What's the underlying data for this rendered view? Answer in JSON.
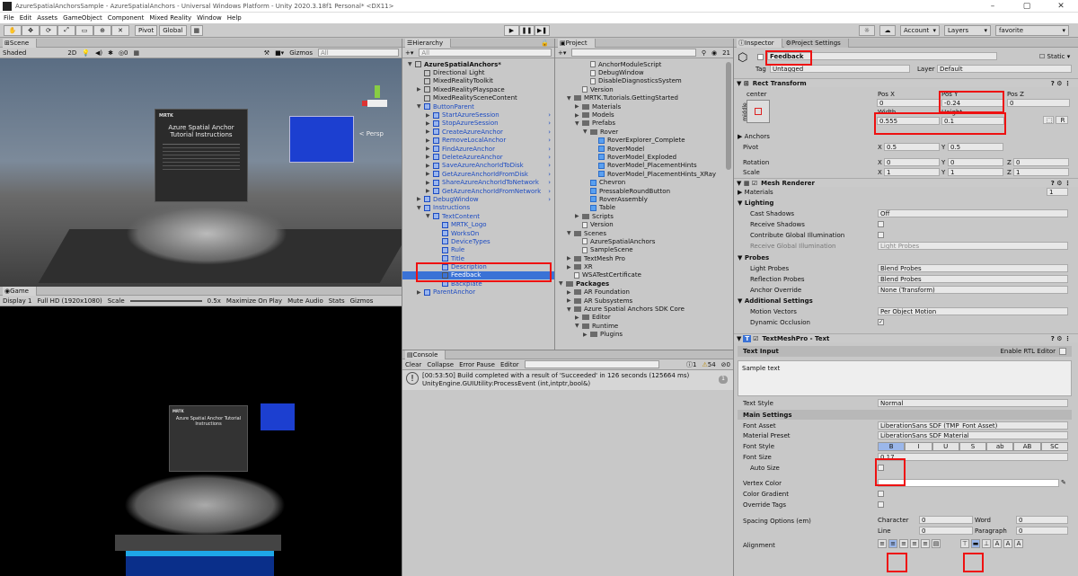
{
  "window": {
    "title": "AzureSpatialAnchorsSample - AzureSpatialAnchors - Universal Windows Platform - Unity 2020.3.18f1 Personal* <DX11>",
    "controls": [
      "–",
      "▢",
      "✕"
    ]
  },
  "menu": [
    "File",
    "Edit",
    "Assets",
    "GameObject",
    "Component",
    "Mixed Reality",
    "Window",
    "Help"
  ],
  "toolbar": {
    "pivot": "Pivot",
    "global": "Global",
    "account": "Account",
    "layers": "Layers",
    "layout": "favorite"
  },
  "scene": {
    "tab": "Scene",
    "shading": "Shaded",
    "mode2d": "2D",
    "gizmos": "Gizmos",
    "search": "All",
    "persp": "< Persp",
    "panel": {
      "brand": "MRTK",
      "title": "Azure Spatial Anchor Tutorial Instructions"
    }
  },
  "game": {
    "tab": "Game",
    "display": "Display 1",
    "resolution": "Full HD (1920x1080)",
    "scale_label": "Scale",
    "scale_value": "0.5x",
    "options": [
      "Maximize On Play",
      "Mute Audio",
      "Stats",
      "Gizmos"
    ],
    "panel": {
      "brand": "MRTK",
      "title": "Azure Spatial Anchor Tutorial Instructions"
    }
  },
  "hierarchy": {
    "tab": "Hierarchy",
    "search": "All",
    "items": [
      {
        "label": "AzureSpatialAnchors*",
        "indent": 0,
        "caret": "▼",
        "kind": "scene"
      },
      {
        "label": "Directional Light",
        "indent": 1,
        "caret": "",
        "kind": "go"
      },
      {
        "label": "MixedRealityToolkit",
        "indent": 1,
        "caret": "",
        "kind": "go"
      },
      {
        "label": "MixedRealityPlayspace",
        "indent": 1,
        "caret": "▶",
        "kind": "go"
      },
      {
        "label": "MixedRealitySceneContent",
        "indent": 1,
        "caret": "",
        "kind": "go"
      },
      {
        "label": "ButtonParent",
        "indent": 1,
        "caret": "▼",
        "kind": "blue"
      },
      {
        "label": "StartAzureSession",
        "indent": 2,
        "caret": "▶",
        "kind": "blue",
        "arrow": true
      },
      {
        "label": "StopAzureSession",
        "indent": 2,
        "caret": "▶",
        "kind": "blue",
        "arrow": true
      },
      {
        "label": "CreateAzureAnchor",
        "indent": 2,
        "caret": "▶",
        "kind": "blue",
        "arrow": true
      },
      {
        "label": "RemoveLocalAnchor",
        "indent": 2,
        "caret": "▶",
        "kind": "blue",
        "arrow": true
      },
      {
        "label": "FindAzureAnchor",
        "indent": 2,
        "caret": "▶",
        "kind": "blue",
        "arrow": true
      },
      {
        "label": "DeleteAzureAnchor",
        "indent": 2,
        "caret": "▶",
        "kind": "blue",
        "arrow": true
      },
      {
        "label": "SaveAzureAnchorIdToDisk",
        "indent": 2,
        "caret": "▶",
        "kind": "blue",
        "arrow": true
      },
      {
        "label": "GetAzureAnchorIdFromDisk",
        "indent": 2,
        "caret": "▶",
        "kind": "blue",
        "arrow": true
      },
      {
        "label": "ShareAzureAnchorIdToNetwork",
        "indent": 2,
        "caret": "▶",
        "kind": "blue",
        "arrow": true
      },
      {
        "label": "GetAzureAnchorIdFromNetwork",
        "indent": 2,
        "caret": "▶",
        "kind": "blue",
        "arrow": true
      },
      {
        "label": "DebugWindow",
        "indent": 1,
        "caret": "▶",
        "kind": "blue",
        "arrow": true
      },
      {
        "label": "Instructions",
        "indent": 1,
        "caret": "▼",
        "kind": "blue"
      },
      {
        "label": "TextContent",
        "indent": 2,
        "caret": "▼",
        "kind": "blue"
      },
      {
        "label": "MRTK_Logo",
        "indent": 3,
        "caret": "",
        "kind": "blue"
      },
      {
        "label": "WorksOn",
        "indent": 3,
        "caret": "",
        "kind": "blue"
      },
      {
        "label": "DeviceTypes",
        "indent": 3,
        "caret": "",
        "kind": "blue"
      },
      {
        "label": "Rule",
        "indent": 3,
        "caret": "",
        "kind": "blue"
      },
      {
        "label": "Title",
        "indent": 3,
        "caret": "",
        "kind": "blue"
      },
      {
        "label": "Description",
        "indent": 3,
        "caret": "",
        "kind": "blue"
      },
      {
        "label": "Feedback",
        "indent": 3,
        "caret": "",
        "kind": "sel"
      },
      {
        "label": "Backplate",
        "indent": 3,
        "caret": "",
        "kind": "blue"
      },
      {
        "label": "ParentAnchor",
        "indent": 1,
        "caret": "▶",
        "kind": "blue"
      }
    ]
  },
  "project": {
    "tab": "Project",
    "count": "21",
    "items": [
      {
        "label": "AnchorModuleScript",
        "indent": 3,
        "kind": "file"
      },
      {
        "label": "DebugWindow",
        "indent": 3,
        "kind": "file"
      },
      {
        "label": "DisableDiagnosticsSystem",
        "indent": 3,
        "kind": "file"
      },
      {
        "label": "Version",
        "indent": 2,
        "kind": "file"
      },
      {
        "label": "MRTK.Tutorials.GettingStarted",
        "indent": 1,
        "kind": "folder",
        "caret": "▼"
      },
      {
        "label": "Materials",
        "indent": 2,
        "kind": "folder",
        "caret": "▶"
      },
      {
        "label": "Models",
        "indent": 2,
        "kind": "folder",
        "caret": "▶"
      },
      {
        "label": "Prefabs",
        "indent": 2,
        "kind": "folder",
        "caret": "▼"
      },
      {
        "label": "Rover",
        "indent": 3,
        "kind": "folder",
        "caret": "▼"
      },
      {
        "label": "RoverExplorer_Complete",
        "indent": 4,
        "kind": "prefab"
      },
      {
        "label": "RoverModel",
        "indent": 4,
        "kind": "prefab"
      },
      {
        "label": "RoverModel_Exploded",
        "indent": 4,
        "kind": "prefab"
      },
      {
        "label": "RoverModel_PlacementHints",
        "indent": 4,
        "kind": "prefab"
      },
      {
        "label": "RoverModel_PlacementHints_XRay",
        "indent": 4,
        "kind": "prefab"
      },
      {
        "label": "Chevron",
        "indent": 3,
        "kind": "prefab"
      },
      {
        "label": "PressableRoundButton",
        "indent": 3,
        "kind": "prefab"
      },
      {
        "label": "RoverAssembly",
        "indent": 3,
        "kind": "prefab"
      },
      {
        "label": "Table",
        "indent": 3,
        "kind": "prefab"
      },
      {
        "label": "Scripts",
        "indent": 2,
        "kind": "folder",
        "caret": "▶"
      },
      {
        "label": "Version",
        "indent": 2,
        "kind": "file"
      },
      {
        "label": "Scenes",
        "indent": 1,
        "kind": "folder",
        "caret": "▼"
      },
      {
        "label": "AzureSpatialAnchors",
        "indent": 2,
        "kind": "file"
      },
      {
        "label": "SampleScene",
        "indent": 2,
        "kind": "file"
      },
      {
        "label": "TextMesh Pro",
        "indent": 1,
        "kind": "folder",
        "caret": "▶"
      },
      {
        "label": "XR",
        "indent": 1,
        "kind": "folder",
        "caret": "▶"
      },
      {
        "label": "WSATestCertificate",
        "indent": 1,
        "kind": "file"
      },
      {
        "label": "Packages",
        "indent": 0,
        "kind": "folder",
        "caret": "▼",
        "bold": true
      },
      {
        "label": "AR Foundation",
        "indent": 1,
        "kind": "folder",
        "caret": "▶"
      },
      {
        "label": "AR Subsystems",
        "indent": 1,
        "kind": "folder",
        "caret": "▶"
      },
      {
        "label": "Azure Spatial Anchors SDK Core",
        "indent": 1,
        "kind": "folder",
        "caret": "▼"
      },
      {
        "label": "Editor",
        "indent": 2,
        "kind": "folder",
        "caret": "▶"
      },
      {
        "label": "Runtime",
        "indent": 2,
        "kind": "folder",
        "caret": "▼"
      },
      {
        "label": "Plugins",
        "indent": 3,
        "kind": "folder",
        "caret": "▶"
      }
    ]
  },
  "console": {
    "tab": "Console",
    "buttons": [
      "Clear",
      "Collapse",
      "Error Pause",
      "Editor"
    ],
    "counts": {
      "info": "1",
      "warn": "54",
      "error": "0"
    },
    "message1": "[00:53:50] Build completed with a result of 'Succeeded' in 126 seconds (125664 ms)",
    "message2": "UnityEngine.GUIUtility:ProcessEvent (int,intptr,bool&)",
    "badge": "1"
  },
  "inspector": {
    "tabs": [
      "Inspector",
      "Project Settings"
    ],
    "name": "Feedback",
    "static": "Static",
    "tag_label": "Tag",
    "tag": "Untagged",
    "layer_label": "Layer",
    "layer": "Default",
    "rect": {
      "title": "Rect Transform",
      "anchor_label": "center",
      "side": "middle",
      "posx_label": "Pos X",
      "posy_label": "Pos Y",
      "posz_label": "Pos Z",
      "posx": "0",
      "posy": "-0.24",
      "posz": "0",
      "width_label": "Width",
      "height_label": "Height",
      "width": "0.555",
      "height": "0.1",
      "r": "R",
      "anchors": "Anchors",
      "pivot": "Pivot",
      "pivot_x": "0.5",
      "pivot_y": "0.5",
      "rotation": "Rotation",
      "rot_x": "0",
      "rot_y": "0",
      "rot_z": "0",
      "scale": "Scale",
      "sc_x": "1",
      "sc_y": "1",
      "sc_z": "1"
    },
    "mesh": {
      "title": "Mesh Renderer",
      "materials": "Materials",
      "materials_count": "1",
      "lighting": "Lighting",
      "cast": "Cast Shadows",
      "cast_val": "Off",
      "receive": "Receive Shadows",
      "contrib": "Contribute Global Illumination",
      "recvgi": "Receive Global Illumination",
      "recvgi_val": "Light Probes",
      "probes": "Probes",
      "light_probes": "Light Probes",
      "light_probes_val": "Blend Probes",
      "refl": "Reflection Probes",
      "refl_val": "Blend Probes",
      "anchor_ov": "Anchor Override",
      "anchor_ov_val": "None (Transform)",
      "additional": "Additional Settings",
      "motion": "Motion Vectors",
      "motion_val": "Per Object Motion",
      "dyn": "Dynamic Occlusion"
    },
    "tmp": {
      "title": "TextMeshPro - Text",
      "text_input": "Text Input",
      "rtl": "Enable RTL Editor",
      "sample": "Sample text",
      "text_style": "Text Style",
      "text_style_val": "Normal",
      "main": "Main Settings",
      "font_asset": "Font Asset",
      "font_asset_val": "LiberationSans SDF (TMP_Font Asset)",
      "mat_preset": "Material Preset",
      "mat_preset_val": "LiberationSans SDF Material",
      "font_style": "Font Style",
      "styles": [
        "B",
        "I",
        "U",
        "S",
        "ab",
        "AB",
        "SC"
      ],
      "font_size": "Font Size",
      "font_size_val": "0.17",
      "auto_size": "Auto Size",
      "vertex": "Vertex Color",
      "gradient": "Color Gradient",
      "override": "Override Tags",
      "spacing": "Spacing Options (em)",
      "character": "Character",
      "character_val": "0",
      "word": "Word",
      "word_val": "0",
      "line": "Line",
      "line_val": "0",
      "paragraph": "Paragraph",
      "paragraph_val": "0",
      "alignment": "Alignment"
    }
  }
}
